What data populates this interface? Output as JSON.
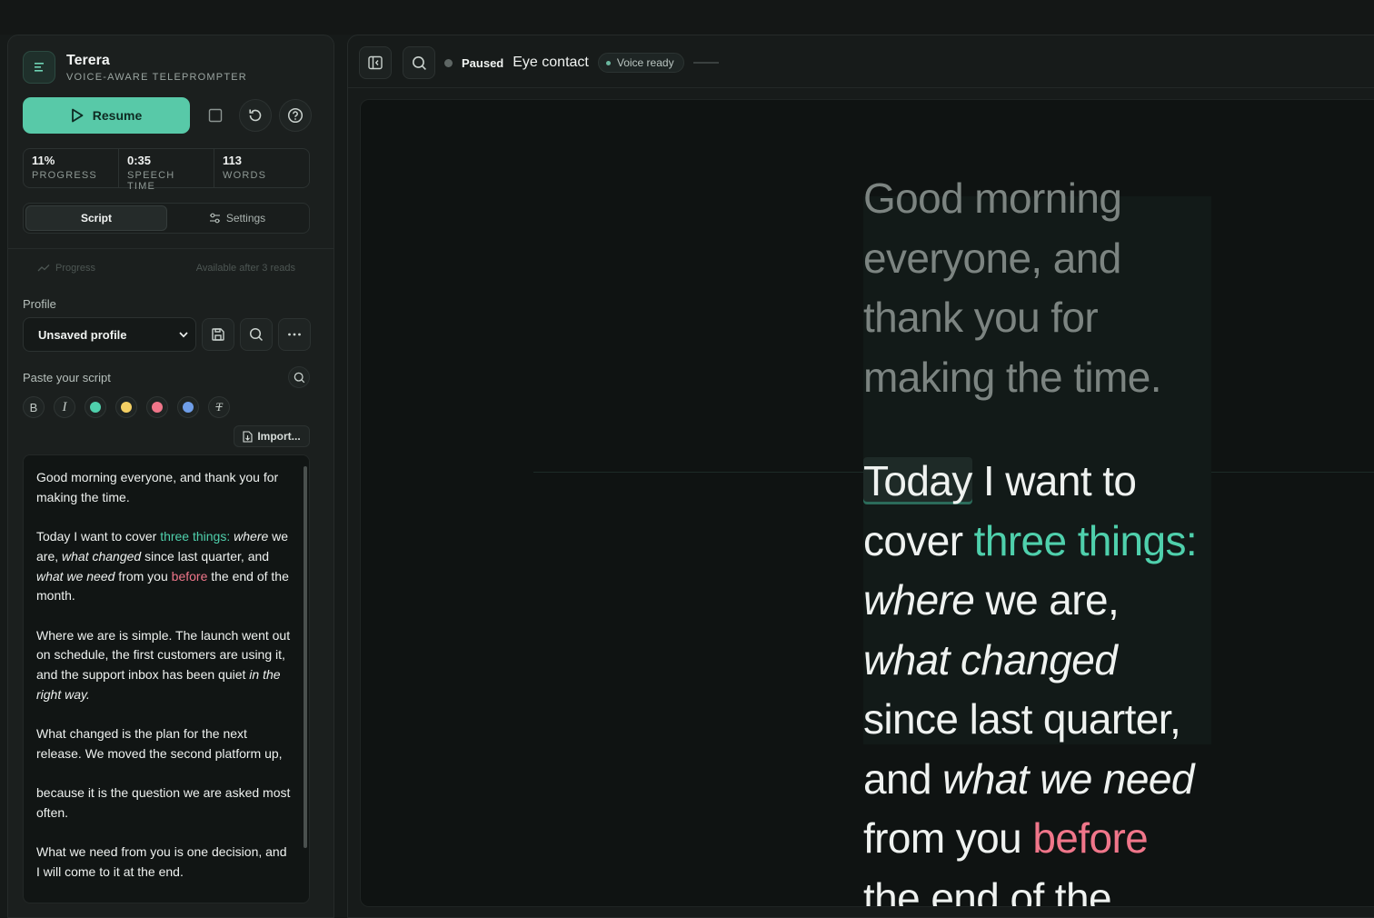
{
  "brand": {
    "name": "Terera",
    "subtitle": "VOICE-AWARE TELEPROMPTER"
  },
  "controls": {
    "resume_label": "Resume"
  },
  "stats": [
    {
      "value": "11%",
      "label": "PROGRESS"
    },
    {
      "value": "0:35",
      "label": "SPEECH TIME"
    },
    {
      "value": "113",
      "label": "WORDS"
    }
  ],
  "tabs": {
    "script": "Script",
    "settings": "Settings"
  },
  "progress_section": {
    "label": "Progress",
    "note": "Available after 3 reads"
  },
  "profile": {
    "label": "Profile",
    "selected": "Unsaved profile"
  },
  "paste": {
    "label": "Paste your script",
    "import_label": "Import..."
  },
  "format": {
    "bold": "B",
    "italic": "I",
    "clear": "T",
    "colors": [
      "#4fd0ac",
      "#f4cf63",
      "#f0768a",
      "#6f9ee8"
    ]
  },
  "script": {
    "p1": "Good morning everyone, and thank you for making the time.",
    "p2_a": "Today I want to cover ",
    "p2_b": "three things:",
    "p2_c": "where",
    "p2_d": " we are, ",
    "p2_e": "what changed",
    "p2_f": " since last quarter, and ",
    "p2_g": "what we need",
    "p2_h": " from you ",
    "p2_i": "before",
    "p2_j": " the end of the month.",
    "p3_a": "Where we are is simple. The launch went out on schedule, the first customers are using it, and the support inbox has been quiet ",
    "p3_b": "in the right way.",
    "p4": "What changed is the plan for the next release. We moved the second platform up,",
    "p5": "because it is the question we are asked most often.",
    "p6": "What we need from you is one decision, and I will come to it at the end."
  },
  "topbar": {
    "status": "Paused",
    "mode": "Eye contact",
    "voice": "Voice ready"
  },
  "prompter": {
    "read_lines": [
      "Good morning",
      "everyone, and",
      "thank you for",
      "making the time."
    ],
    "current_word": "Today",
    "l1_rest": " I want to",
    "l2_a": "cover ",
    "l2_b": "three things:",
    "l3_a": "where",
    "l3_b": " we are,",
    "l4": "what changed",
    "l5": "since last quarter,",
    "l6_a": "and ",
    "l6_b": "what we need",
    "l7_a": "from you ",
    "l7_b": "before",
    "l8": "the end of the"
  }
}
